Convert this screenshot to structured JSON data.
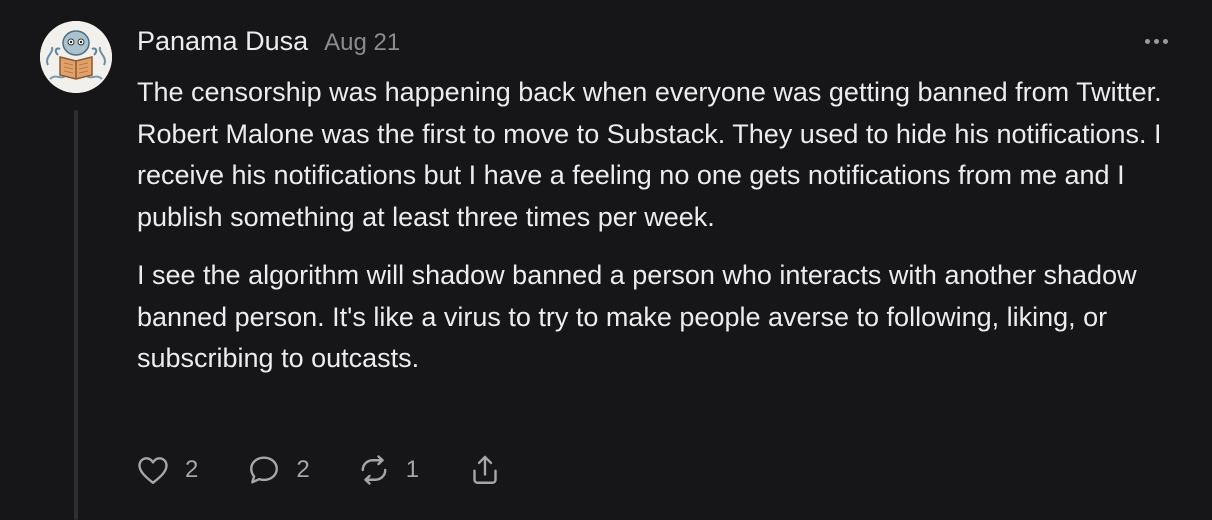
{
  "comment": {
    "author": "Panama Dusa",
    "date": "Aug 21",
    "paragraphs": [
      "The censorship was happening back when everyone was getting banned from Twitter. Robert Malone was the first to move to Substack. They used to hide his notifications. I receive his notifications but I have a feeling no one gets notifications from me and I publish something at least three times per week.",
      "I see the algorithm will shadow banned a person who interacts with another shadow banned person. It's like a virus to try to make people averse to following, liking, or subscribing to outcasts."
    ],
    "actions": {
      "likes": "2",
      "comments": "2",
      "restacks": "1"
    }
  },
  "icons": {
    "like": "heart-icon",
    "comment": "speech-bubble-icon",
    "restack": "restack-arrows-icon",
    "share": "share-icon",
    "more": "more-horizontal-icon"
  },
  "colors": {
    "background": "#161618",
    "text": "#ececec",
    "muted": "#8b8b8e",
    "icon": "#a6a6a9",
    "thread_line": "#2f2f32"
  }
}
